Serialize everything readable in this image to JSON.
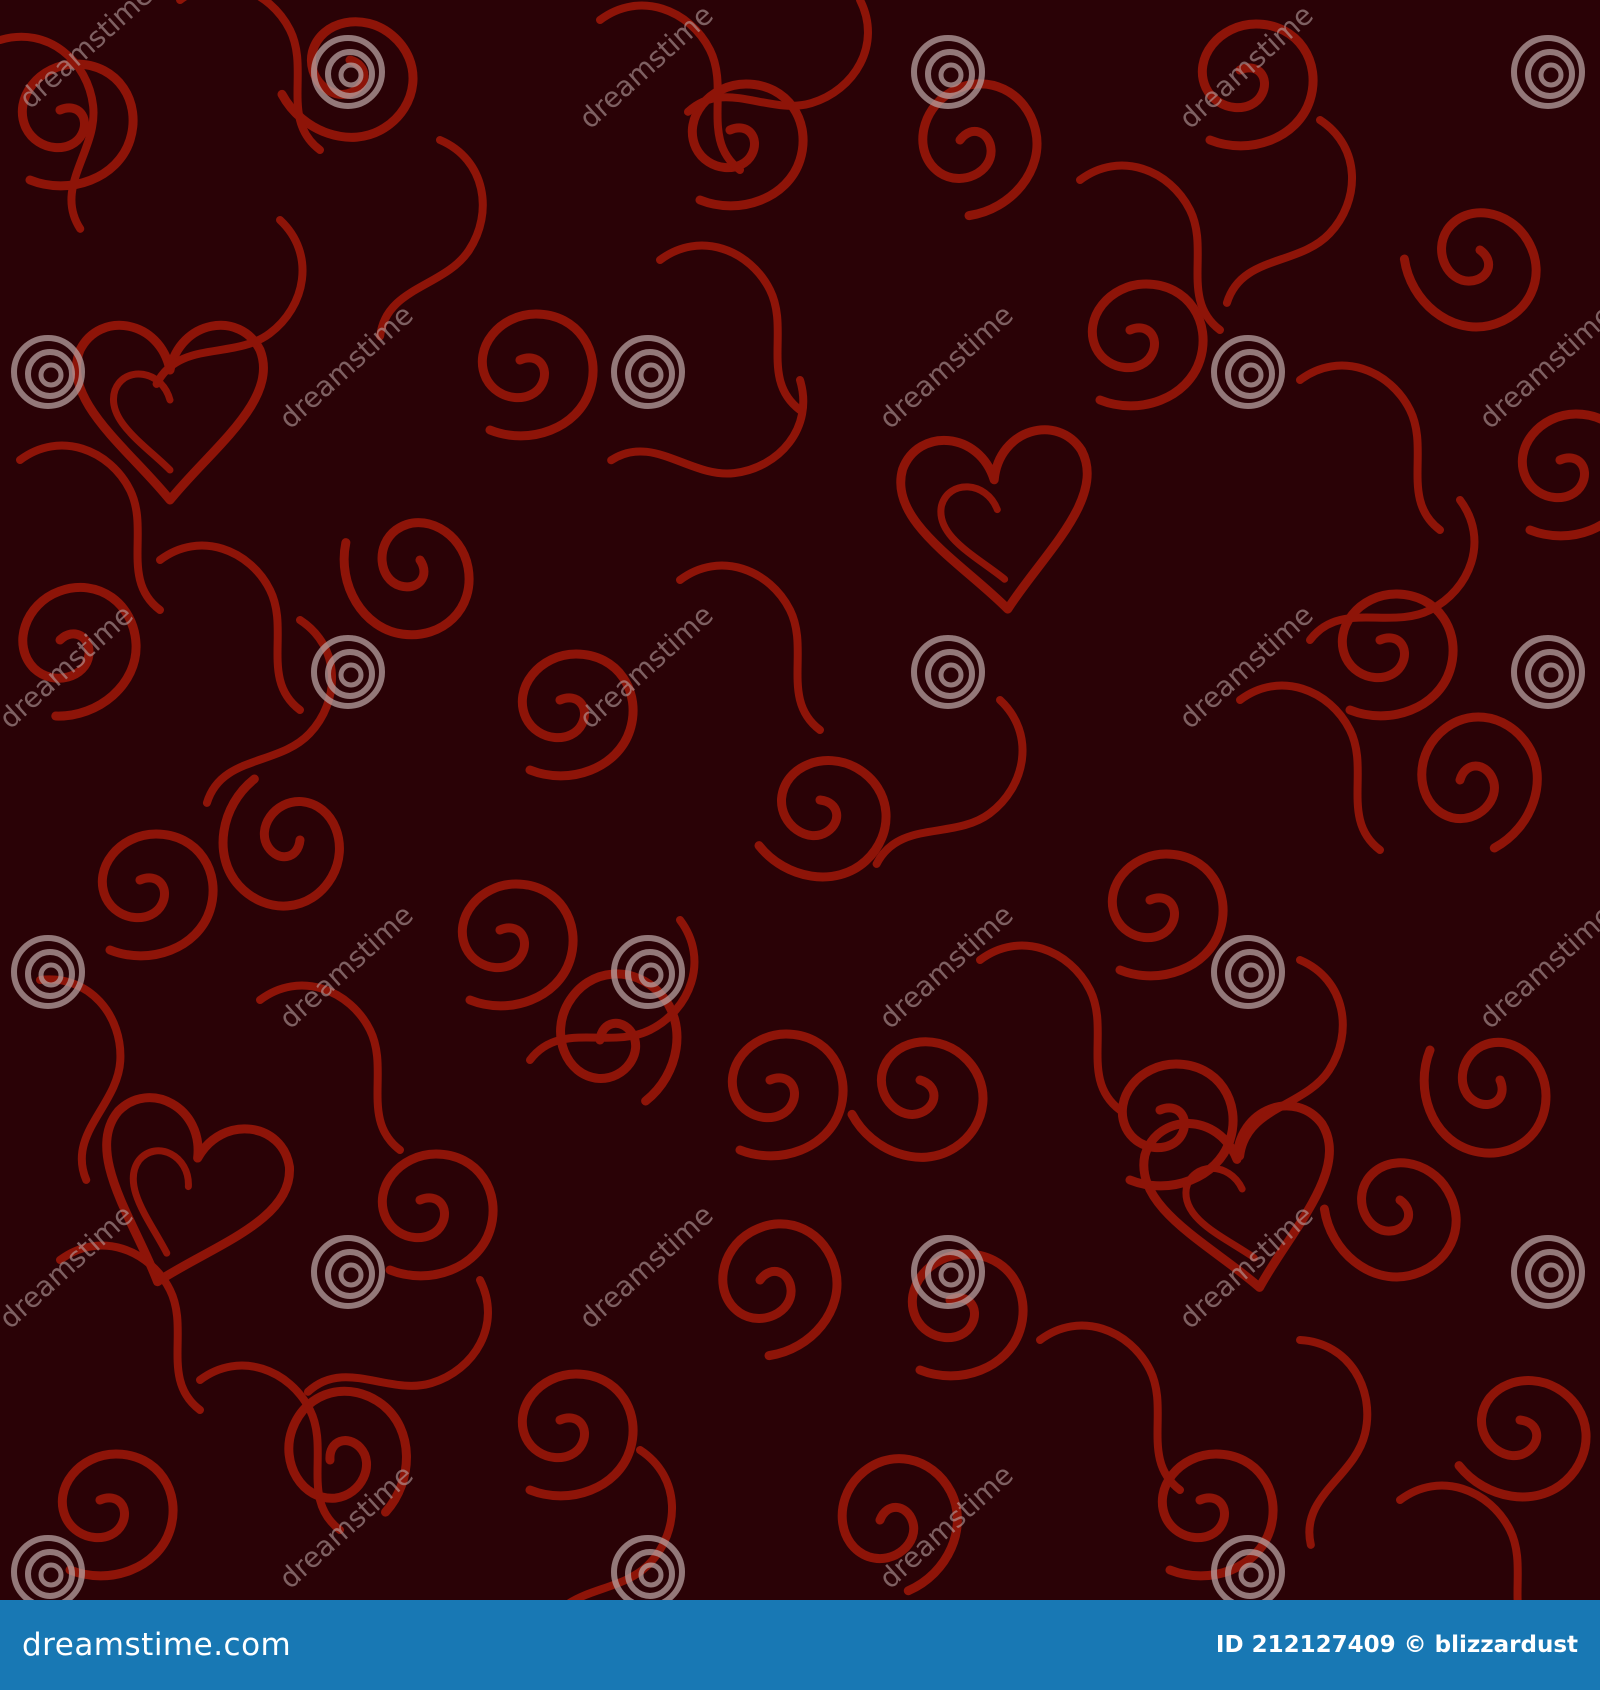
{
  "image": {
    "description_colors": {
      "background": "#2a0206",
      "ornament": "#8e1408",
      "watermark": "#b7a0a0",
      "footer_bar": "#1878b4",
      "footer_text": "#ffffff"
    },
    "ornament_icons": [
      "swirl-icon",
      "heart-icon",
      "ribbon-stroke-icon"
    ],
    "watermark": {
      "text": "dreamstime",
      "icon": "spiral-logo-icon"
    }
  },
  "footer": {
    "brand": "dreamstime.com",
    "id_label": "ID 212127409",
    "copyright_symbol": "©",
    "author": "blizzardust"
  }
}
